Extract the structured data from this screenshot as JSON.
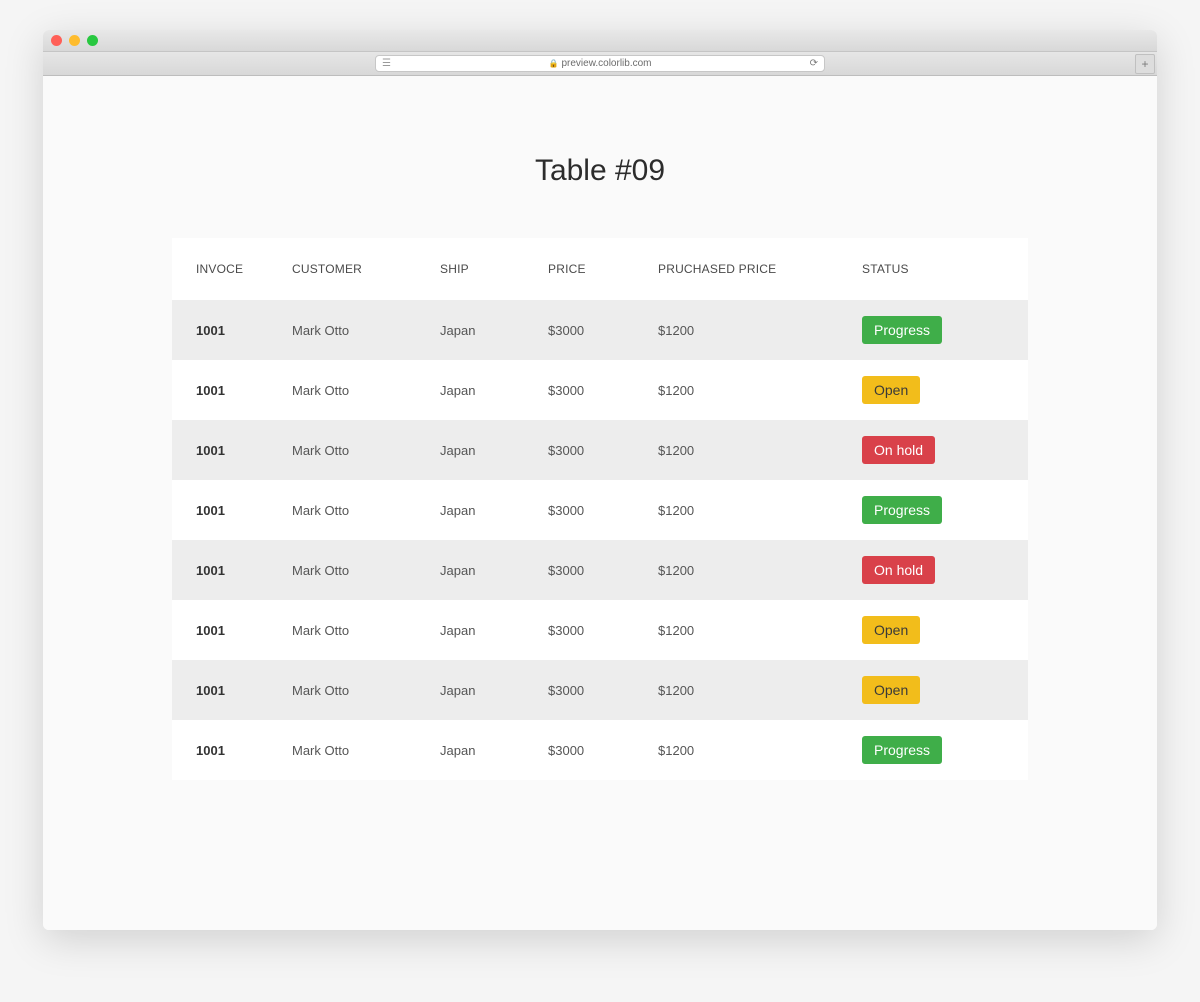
{
  "browser": {
    "address": "preview.colorlib.com"
  },
  "page": {
    "title": "Table #09"
  },
  "table": {
    "headers": {
      "invoice": "INVOCE",
      "customer": "CUSTOMER",
      "ship": "SHIP",
      "price": "PRICE",
      "purchased": "PRUCHASED PRICE",
      "status": "STATUS"
    },
    "rows": [
      {
        "invoice": "1001",
        "customer": "Mark Otto",
        "ship": "Japan",
        "price": "$3000",
        "purchased": "$1200",
        "status": "Progress",
        "status_type": "progress"
      },
      {
        "invoice": "1001",
        "customer": "Mark Otto",
        "ship": "Japan",
        "price": "$3000",
        "purchased": "$1200",
        "status": "Open",
        "status_type": "open"
      },
      {
        "invoice": "1001",
        "customer": "Mark Otto",
        "ship": "Japan",
        "price": "$3000",
        "purchased": "$1200",
        "status": "On hold",
        "status_type": "onhold"
      },
      {
        "invoice": "1001",
        "customer": "Mark Otto",
        "ship": "Japan",
        "price": "$3000",
        "purchased": "$1200",
        "status": "Progress",
        "status_type": "progress"
      },
      {
        "invoice": "1001",
        "customer": "Mark Otto",
        "ship": "Japan",
        "price": "$3000",
        "purchased": "$1200",
        "status": "On hold",
        "status_type": "onhold"
      },
      {
        "invoice": "1001",
        "customer": "Mark Otto",
        "ship": "Japan",
        "price": "$3000",
        "purchased": "$1200",
        "status": "Open",
        "status_type": "open"
      },
      {
        "invoice": "1001",
        "customer": "Mark Otto",
        "ship": "Japan",
        "price": "$3000",
        "purchased": "$1200",
        "status": "Open",
        "status_type": "open"
      },
      {
        "invoice": "1001",
        "customer": "Mark Otto",
        "ship": "Japan",
        "price": "$3000",
        "purchased": "$1200",
        "status": "Progress",
        "status_type": "progress"
      }
    ]
  },
  "colors": {
    "progress": "#3fae49",
    "open": "#f2bd1b",
    "onhold": "#d9414a"
  }
}
